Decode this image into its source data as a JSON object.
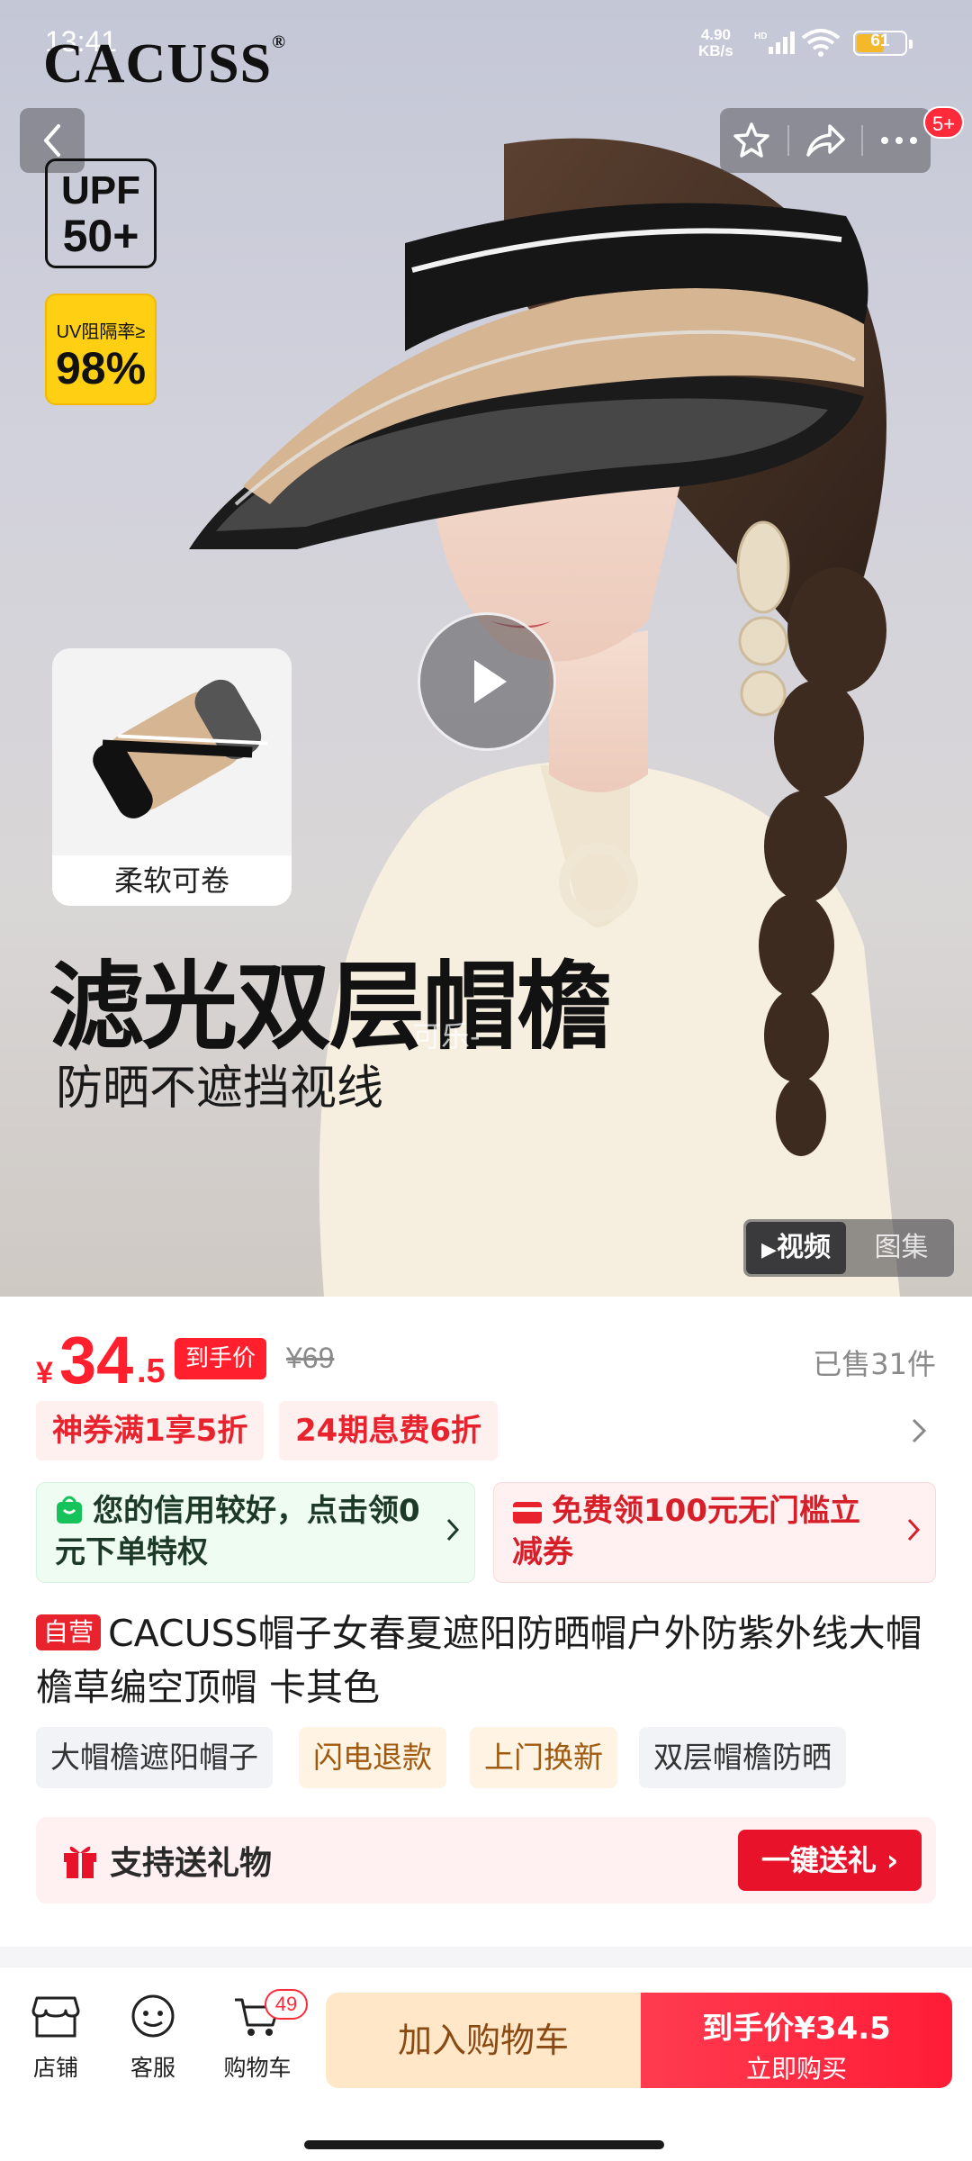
{
  "status_bar": {
    "time": "13:41",
    "net_speed_value": "4.90",
    "net_speed_unit": "KB/s",
    "net_label": "HD",
    "battery": "61",
    "battery_level": 0.61
  },
  "hero": {
    "brand": "CACUSS",
    "brand_mark": "®",
    "upf_line1": "UPF",
    "upf_line2": "50+",
    "uv_line1": "UV阻隔率≥",
    "uv_line2": "98%",
    "roll_card_caption": "柔软可卷",
    "title": "滤光双层帽檐",
    "subtitle": "防晒不遮挡视线",
    "watermark": "可乐-",
    "notification_count": "5+",
    "media_tabs": [
      {
        "label": "视频",
        "active": true
      },
      {
        "label": "图集",
        "active": false
      }
    ]
  },
  "price": {
    "symbol": "¥",
    "integer": "34",
    "decimal": ".5",
    "tag": "到手价",
    "original": "¥69",
    "sold": "已售31件"
  },
  "coupons": [
    "神券满1享5折",
    "24期息费6折"
  ],
  "promos": {
    "credit": "您的信用较好，点击领0元下单特权",
    "voucher": "免费领100元无门槛立减券"
  },
  "product": {
    "badge": "自营",
    "title": "CACUSS帽子女春夏遮阳防晒帽户外防紫外线大帽檐草编空顶帽 卡其色"
  },
  "tags": [
    "大帽檐遮阳帽子",
    "闪电退款",
    "上门换新",
    "双层帽檐防晒"
  ],
  "gift": {
    "text": "支持送礼物",
    "button": "一键送礼"
  },
  "bottom_nav": {
    "store": "店铺",
    "service": "客服",
    "cart": "购物车",
    "cart_count": "49",
    "add_to_cart": "加入购物车",
    "buy_line1": "到手价¥34.5",
    "buy_line2": "立即购买"
  },
  "colors": {
    "accent_red": "#ff1f2d",
    "add_cart_bg": "#ffe7c8"
  }
}
